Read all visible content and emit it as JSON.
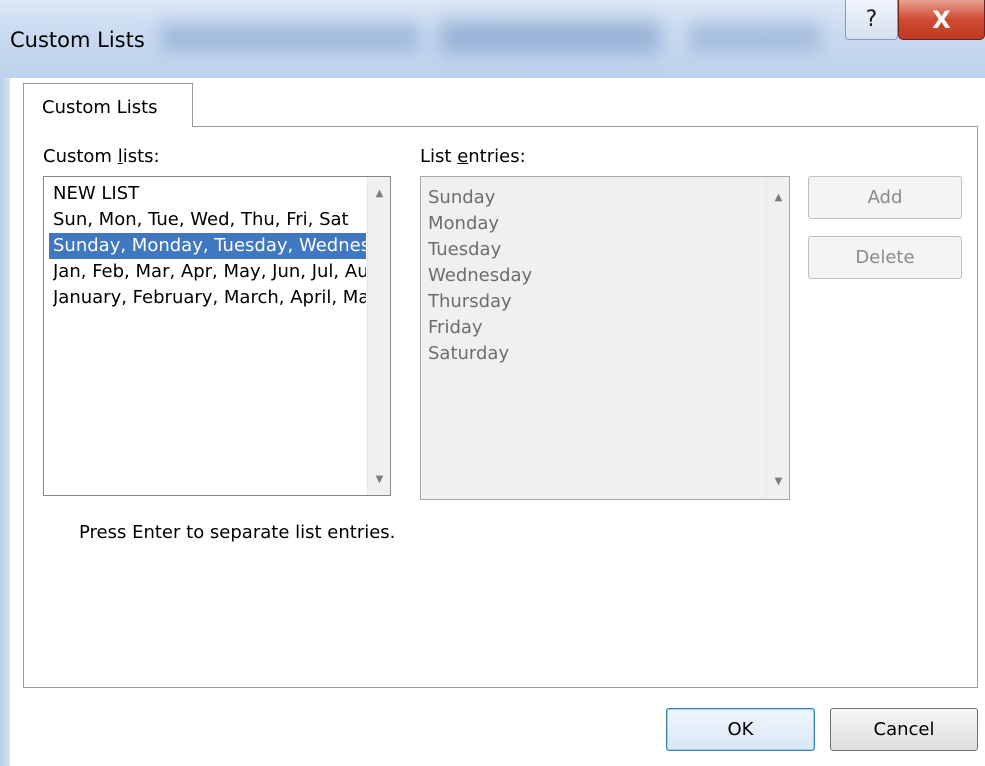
{
  "window": {
    "title": "Custom Lists",
    "help_label": "?",
    "close_label": "X"
  },
  "tabs": [
    {
      "label": "Custom Lists",
      "selected": true
    }
  ],
  "custom_lists": {
    "label_prefix": "Custom ",
    "label_accel": "l",
    "label_suffix": "ists:",
    "items": [
      {
        "label": "NEW LIST",
        "selected": false
      },
      {
        "label": "Sun, Mon, Tue, Wed, Thu, Fri, Sat",
        "selected": false
      },
      {
        "label": "Sunday, Monday, Tuesday, Wednesday, Thursday, Friday, Saturday",
        "selected": true
      },
      {
        "label": "Jan, Feb, Mar, Apr, May, Jun, Jul, Aug, Sep, Oct, Nov, Dec",
        "selected": false
      },
      {
        "label": "January, February, March, April, May, June, July, August, September, October, November, December",
        "selected": false
      }
    ]
  },
  "list_entries": {
    "label_prefix": "List ",
    "label_accel": "e",
    "label_suffix": "ntries:",
    "values": [
      "Sunday",
      "Monday",
      "Tuesday",
      "Wednesday",
      "Thursday",
      "Friday",
      "Saturday"
    ]
  },
  "buttons": {
    "add": "Add",
    "delete": "Delete",
    "ok": "OK",
    "cancel": "Cancel"
  },
  "hint": "Press Enter to separate list entries.",
  "colors": {
    "selection": "#3f77c1",
    "close_button": "#c9452e",
    "title_bar": "#c9daf0"
  }
}
